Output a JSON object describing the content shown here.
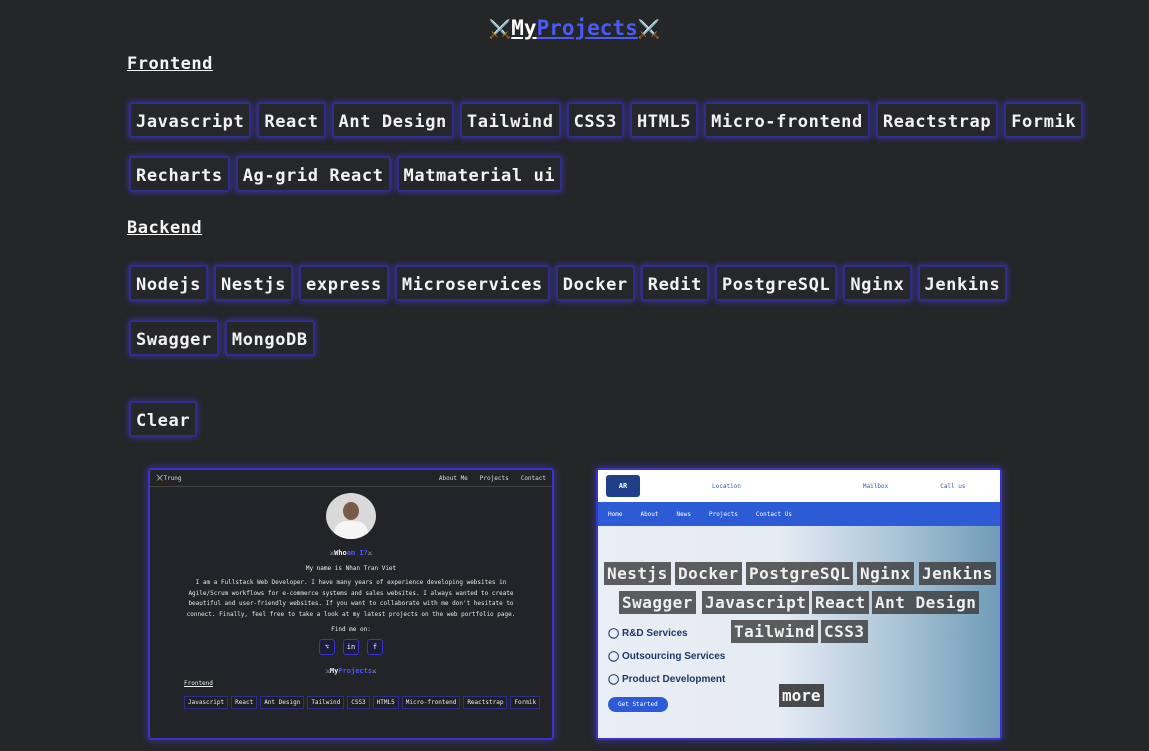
{
  "title": {
    "prefix_icon": "⚔️",
    "my": "My",
    "projects": "Projects",
    "suffix_icon": "⚔️"
  },
  "frontend": {
    "heading": "Frontend",
    "row1": [
      "Javascript",
      "React",
      "Ant Design",
      "Tailwind",
      "CSS3",
      "HTML5",
      "Micro-frontend",
      "Reactstrap",
      "Formik"
    ],
    "row2": [
      "Recharts",
      "Ag-grid React",
      "Matmaterial ui"
    ]
  },
  "backend": {
    "heading": "Backend",
    "row1": [
      "Nodejs",
      "Nestjs",
      "express",
      "Microservices",
      "Docker",
      "Redit",
      "PostgreSQL",
      "Nginx",
      "Jenkins"
    ],
    "row2": [
      "Swagger",
      "MongoDB"
    ]
  },
  "clear_label": "Clear",
  "card1": {
    "brand": "⚔️Trung",
    "nav": [
      "About Me",
      "Projects",
      "Contact"
    ],
    "who": "Who",
    "who_blue": "am I?",
    "name": "My name is Nhan Tran Viet",
    "paragraph": "I am a Fullstack Web Developer. I have many years of experience developing websites in Agile/Scrum workflows for e-commerce systems and sales websites. I always wanted to create beautiful and user-friendly websites. If you want to collaborate with me don't hesitate to connect. Finally, feel free to take a look at my latest projects on the web portfolio page.",
    "find": "Find me on:",
    "socials": [
      "⌥",
      "in",
      "f"
    ],
    "mini_title_my": "My",
    "mini_title_proj": "Projects",
    "mini_frontend": "Frontend",
    "mini_chips": [
      "Javascript",
      "React",
      "Ant Design",
      "Tailwind",
      "CSS3",
      "HTML5",
      "Micro-frontend",
      "Reactstrap",
      "Formik"
    ]
  },
  "card2": {
    "logo": "AR",
    "header_items": [
      "Location",
      "Mailbox",
      "Call us"
    ],
    "nav": [
      "Home",
      "About",
      "News",
      "Projects",
      "Contact Us"
    ],
    "services": [
      "R&D Services",
      "Outsourcing Services",
      "Product Development"
    ],
    "get_started": "Get Started",
    "overlay_row1": [
      "Nestjs",
      "Docker",
      "PostgreSQL",
      "Nginx",
      "Jenkins"
    ],
    "overlay_row2": [
      "Swagger",
      "Javascript",
      "React",
      "Ant Design"
    ],
    "overlay_row3": [
      "Tailwind",
      "CSS3"
    ],
    "more": "more"
  }
}
